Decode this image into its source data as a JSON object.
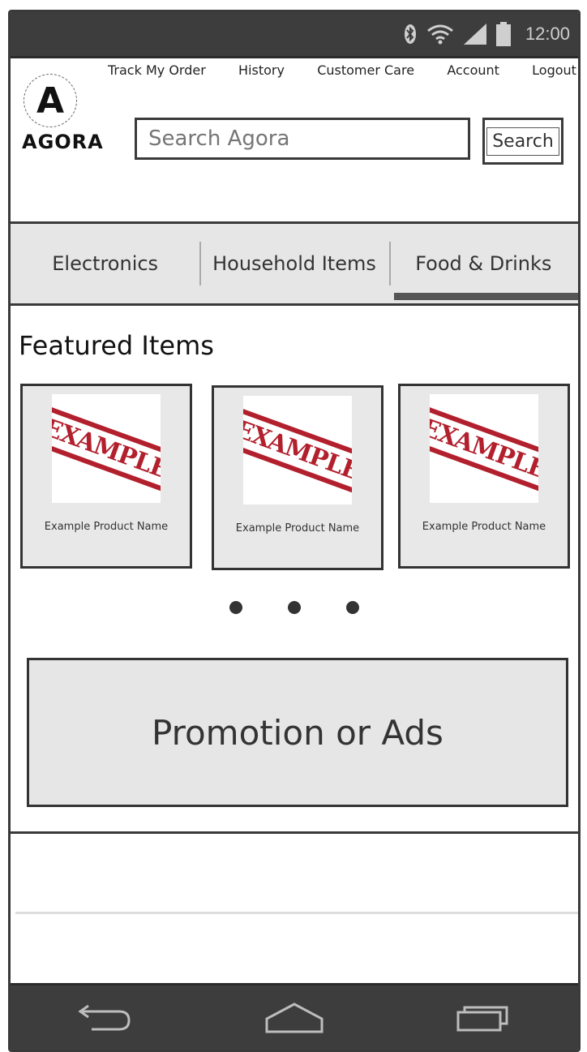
{
  "status_bar": {
    "time": "12:00",
    "icons": [
      "bluetooth-icon",
      "wifi-icon",
      "signal-icon",
      "battery-icon"
    ]
  },
  "header": {
    "nav": [
      "Track My Order",
      "History",
      "Customer Care",
      "Account",
      "Logout"
    ],
    "logo_letter": "A",
    "logo_word": "AGORA",
    "search_placeholder": "Search Agora",
    "search_button": "Search"
  },
  "tabs": [
    {
      "label": "Electronics",
      "active": false
    },
    {
      "label": "Household Items",
      "active": false
    },
    {
      "label": "Food & Drinks",
      "active": true
    }
  ],
  "featured": {
    "title": "Featured Items",
    "items": [
      {
        "image_text": "EXAMPLE",
        "name": "Example Product Name"
      },
      {
        "image_text": "EXAMPLE",
        "name": "Example Product Name"
      },
      {
        "image_text": "EXAMPLE",
        "name": "Example Product Name"
      }
    ]
  },
  "promo": {
    "label": "Promotion or Ads"
  },
  "navbar": {
    "icons": [
      "back-icon",
      "home-icon",
      "recent-apps-icon"
    ]
  }
}
